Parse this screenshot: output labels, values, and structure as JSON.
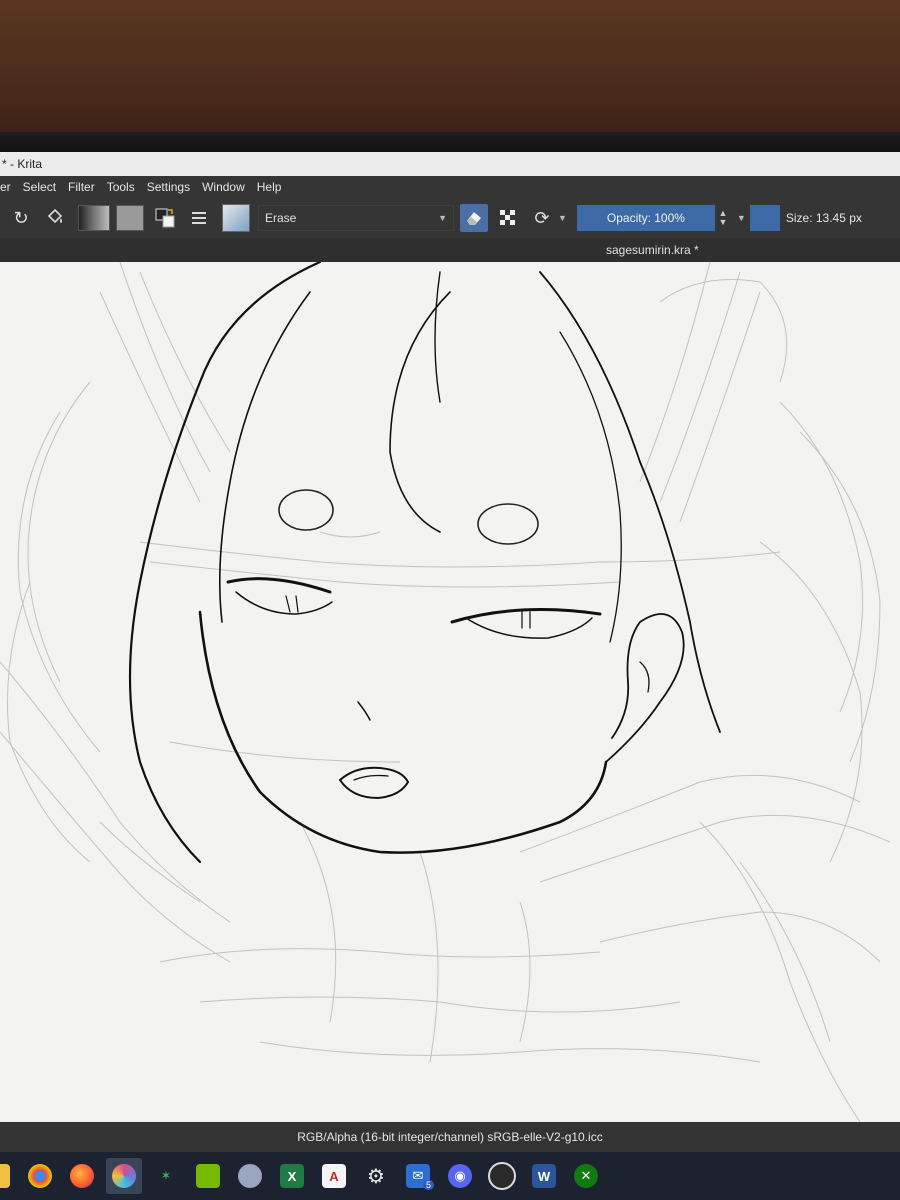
{
  "window": {
    "title": "* - Krita"
  },
  "menu": [
    "yer",
    "Select",
    "Filter",
    "Tools",
    "Settings",
    "Window",
    "Help"
  ],
  "toolbar": {
    "blend_mode": "Erase",
    "opacity_label": "Opacity: 100%",
    "size_label": "Size: 13.45 px"
  },
  "document": {
    "tab_title": "sagesumirin.kra *"
  },
  "status": {
    "color_space": "RGB/Alpha (16-bit integer/channel)  sRGB-elle-V2-g10.icc"
  },
  "taskbar": {
    "items": [
      {
        "name": "overflow",
        "color": "#f0c040"
      },
      {
        "name": "chrome",
        "color": "#e04a3a"
      },
      {
        "name": "firefox",
        "color": "#ff7a2a"
      },
      {
        "name": "krita",
        "color": "#6a7ad8"
      },
      {
        "name": "app-green-star",
        "color": "#44aa55"
      },
      {
        "name": "nvidia",
        "color": "#76b900"
      },
      {
        "name": "brain-app",
        "color": "#9aa6c0"
      },
      {
        "name": "excel",
        "color": "#1f7a44"
      },
      {
        "name": "acrobat",
        "color": "#c62c2c"
      },
      {
        "name": "settings",
        "color": "#8a8f9a"
      },
      {
        "name": "mail",
        "color": "#2d6fd0"
      },
      {
        "name": "discord",
        "color": "#5865f2"
      },
      {
        "name": "obs",
        "color": "#555"
      },
      {
        "name": "word",
        "color": "#2b579a"
      },
      {
        "name": "xbox",
        "color": "#107c10"
      }
    ],
    "mail_badge": "5"
  }
}
